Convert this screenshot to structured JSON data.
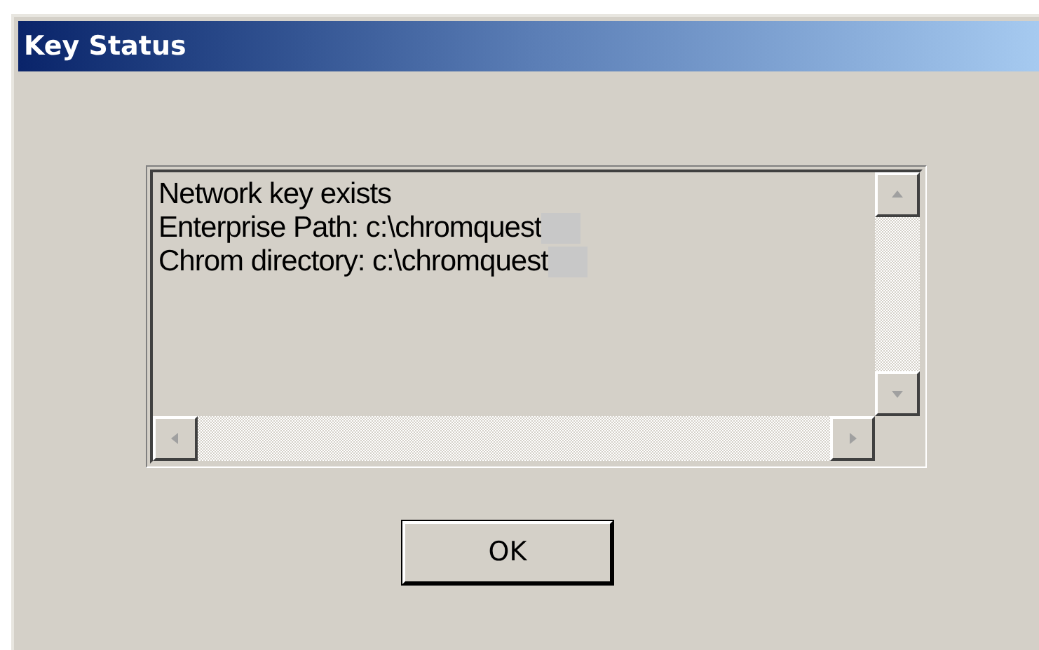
{
  "window": {
    "title": "Key Status"
  },
  "text_box": {
    "lines": [
      "Network key exists",
      "Enterprise Path: c:\\chromquest",
      "Chrom directory: c:\\chromquest"
    ]
  },
  "buttons": [
    {
      "label": "OK"
    }
  ]
}
